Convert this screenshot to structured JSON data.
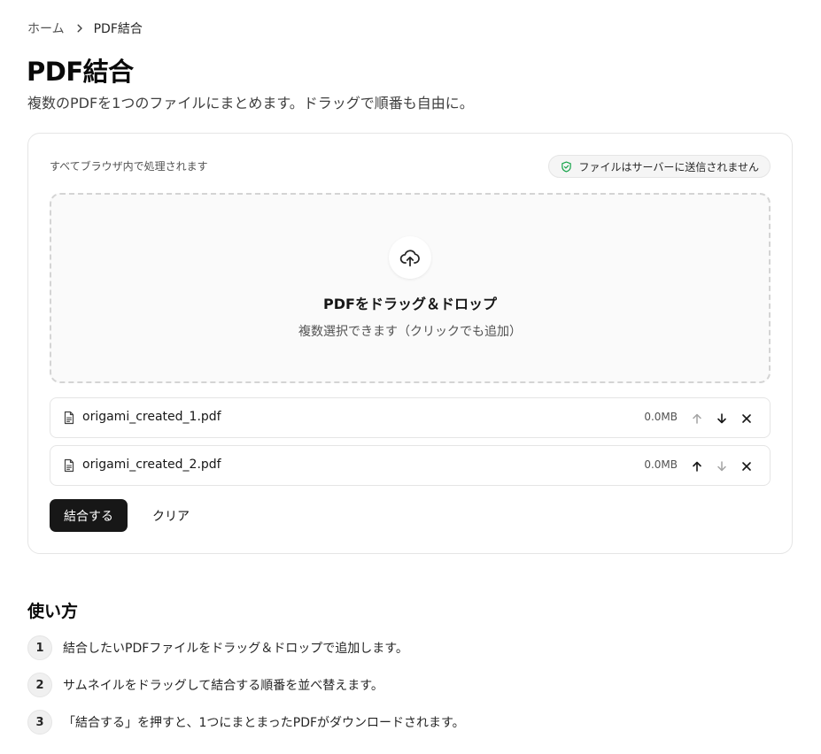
{
  "breadcrumb": {
    "home": "ホーム",
    "current": "PDF結合"
  },
  "page": {
    "title": "PDF結合",
    "description": "複数のPDFを1つのファイルにまとめます。ドラッグで順番も自由に。"
  },
  "card": {
    "note": "すべてブラウザ内で処理されます",
    "privacy_badge": "ファイルはサーバーに送信されません"
  },
  "dropzone": {
    "title": "PDFをドラッグ＆ドロップ",
    "subtitle": "複数選択できます（クリックでも追加）"
  },
  "files": [
    {
      "name": "origami_created_1.pdf",
      "size": "0.0MB",
      "can_move_up": false,
      "can_move_down": true
    },
    {
      "name": "origami_created_2.pdf",
      "size": "0.0MB",
      "can_move_up": true,
      "can_move_down": false
    }
  ],
  "actions": {
    "merge_label": "結合する",
    "clear_label": "クリア"
  },
  "howto": {
    "title": "使い方",
    "steps": [
      {
        "num": "1",
        "text": "結合したいPDFファイルをドラッグ＆ドロップで追加します。"
      },
      {
        "num": "2",
        "text": "サムネイルをドラッグして結合する順番を並べ替えます。"
      },
      {
        "num": "3",
        "text": "「結合する」を押すと、1つにまとまったPDFがダウンロードされます。"
      }
    ]
  },
  "colors": {
    "primary": "#171717",
    "badge_icon": "#16a34a",
    "muted": "#525252",
    "disabled": "#a3a3a3"
  },
  "icons": [
    "chevron-right-icon",
    "shield-check-icon",
    "upload-cloud-icon",
    "file-text-icon",
    "arrow-up-icon",
    "arrow-down-icon",
    "close-icon"
  ]
}
